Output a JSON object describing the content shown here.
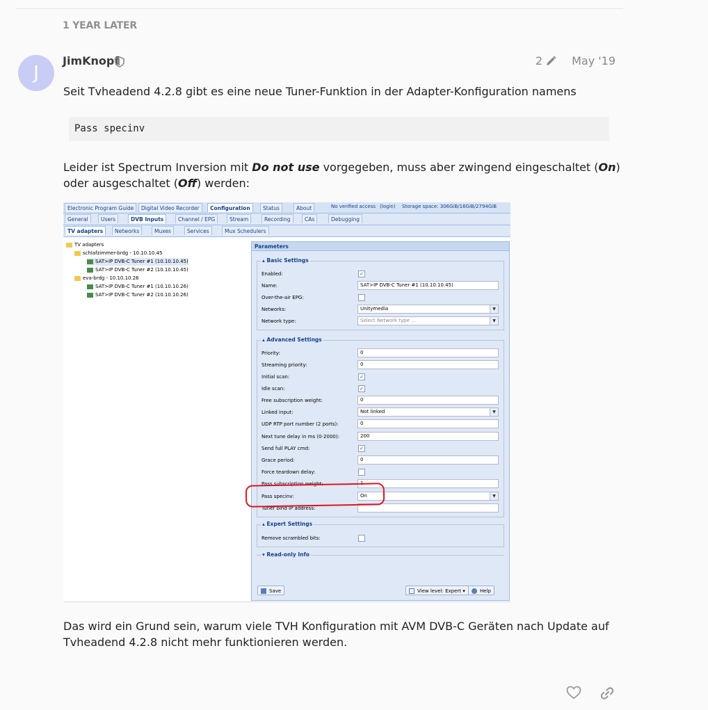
{
  "time_gap": "1 YEAR LATER",
  "post": {
    "avatar_letter": "J",
    "username": "JimKnopf",
    "edit_count": "2",
    "date": "May '19",
    "para1": "Seit Tvheadend 4.2.8 gibt es eine neue Tuner-Funktion in der Adapter-Konfiguration namens",
    "code": "Pass specinv",
    "para2a": "Leider ist Spectrum Inversion mit ",
    "para2b": "Do not use",
    "para2c": " vorgegeben, muss aber zwingend eingeschaltet (",
    "para2d": "On",
    "para2e": ")",
    "para2f": "oder ausgeschaltet (",
    "para2g": "Off",
    "para2h": ") werden:",
    "para3a": "Das wird ein Grund sein, warum viele TVH Konfiguration mit AVM DVB-C Geräten nach Update auf",
    "para3b": "Tvheadend 4.2.8 nicht mehr funktionieren werden."
  },
  "screenshot": {
    "tabs_row1": [
      "Electronic Program Guide",
      "Digital Video Recorder",
      "Configuration",
      "Status",
      "About"
    ],
    "access": "No verified access",
    "login": "(login)",
    "storage": "Storage space: 306GiB/16GiB/2794GiB",
    "tabs_row2": [
      "General",
      "Users",
      "DVB Inputs",
      "Channel / EPG",
      "Stream",
      "Recording",
      "CAs",
      "Debugging"
    ],
    "tabs_row3": [
      "TV adapters",
      "Networks",
      "Muxes",
      "Services",
      "Mux Schedulers"
    ],
    "tree": [
      "TV adapters",
      "schlafzimmer-brdg - 10.10.10.45",
      "SAT>IP DVB-C Tuner #1 (10.10.10.45)",
      "SAT>IP DVB-C Tuner #2 (10.10.10.45)",
      "eva-brdg - 10.10.10.26",
      "SAT>IP DVB-C Tuner #1 (10.10.10.26)",
      "SAT>IP DVB-C Tuner #2 (10.10.10.26)"
    ],
    "panel_title": "Parameters",
    "basic_legend": "Basic Settings",
    "basic": {
      "enabled": "Enabled:",
      "name": "Name:",
      "name_value": "SAT>IP DVB-C Tuner #1 (10.10.10.45)",
      "ota_epg": "Over-the-air EPG:",
      "networks": "Networks:",
      "networks_value": "Unitymedia",
      "network_type": "Network type:",
      "network_type_ph": "Select Network type ..."
    },
    "adv_legend": "Advanced Settings",
    "adv": {
      "priority": "Priority:",
      "priority_value": "0",
      "stream_priority": "Streaming priority:",
      "stream_priority_value": "0",
      "initial_scan": "Initial scan:",
      "idle_scan": "Idle scan:",
      "free_sub": "Free subscription weight:",
      "free_sub_value": "0",
      "linked_input": "Linked input:",
      "linked_input_value": "Not linked",
      "udp_rtp": "UDP RTP port number (2 ports):",
      "udp_rtp_value": "0",
      "next_tune": "Next tune delay in ms (0-2000):",
      "next_tune_value": "200",
      "full_play": "Send full PLAY cmd:",
      "grace": "Grace period:",
      "grace_value": "0",
      "force_teardown": "Force teardown delay:",
      "pass_sub": "Pass subscription weight:",
      "pass_sub_value": "1",
      "pass_specinv": "Pass specinv:",
      "pass_specinv_value": "On",
      "tuner_bind": "Tuner bind IP address:"
    },
    "expert_legend": "Expert Settings",
    "remove_scrambled": "Remove scrambled bits:",
    "readonly_legend": "Read-only Info",
    "save": "Save",
    "view_level": "View level: Expert",
    "help": "Help"
  },
  "colors": {
    "avatar": "#c9cdf6",
    "highlight": "#e0141e",
    "ext_blue": "#15428b"
  }
}
